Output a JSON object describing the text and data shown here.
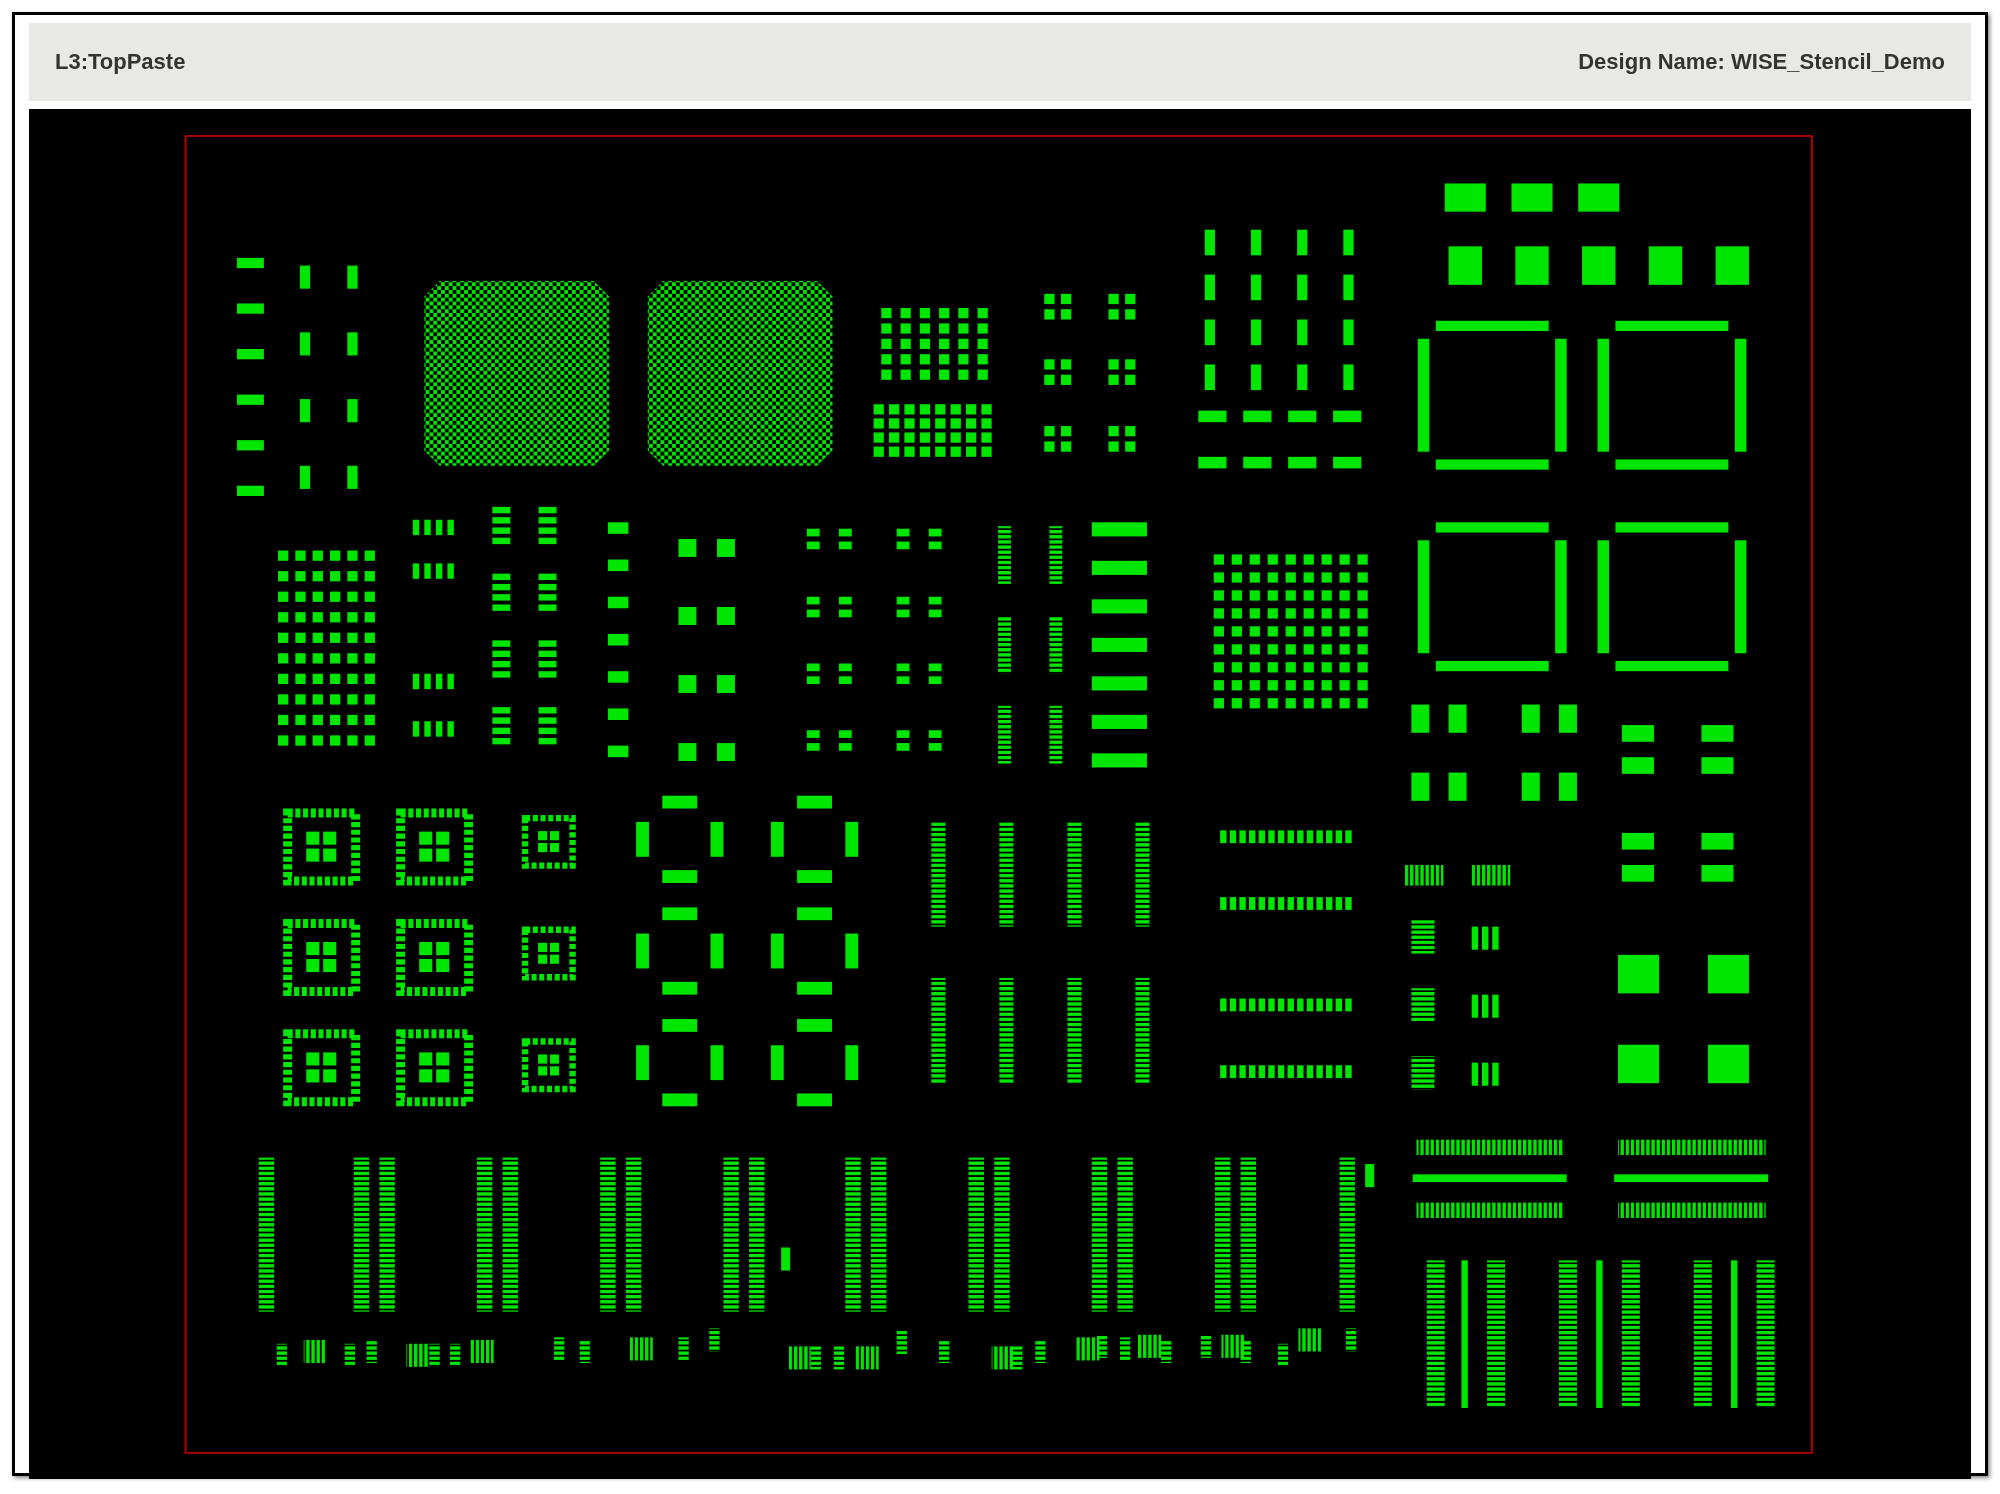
{
  "header": {
    "layer": "L3:TopPaste",
    "design_name": "Design Name: WISE_Stencil_Demo"
  }
}
